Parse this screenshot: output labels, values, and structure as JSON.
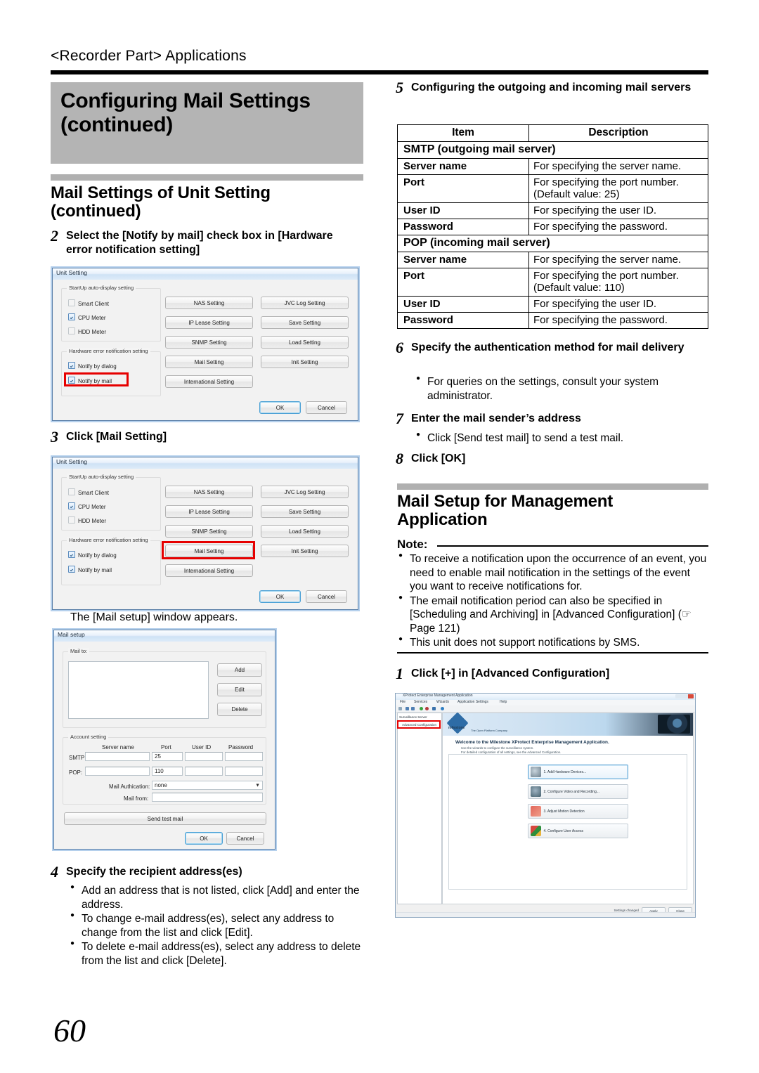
{
  "running_head": "<Recorder Part> Applications",
  "chapter_title": "Configuring Mail Settings\n(continued)",
  "page_number": "60",
  "left_column": {
    "section_heading": "Mail Settings of Unit Setting\n(continued)",
    "step2": {
      "num": "2",
      "text": "Select the [Notify by mail] check box in [Hardware error notification setting]"
    },
    "step3": {
      "num": "3",
      "text": "Click [Mail Setting]"
    },
    "caption_mail_setup": "The [Mail setup] window appears.",
    "step4": {
      "num": "4",
      "text": "Specify the recipient address(es)",
      "bullets": [
        "Add an address that is not listed, click [Add] and enter the address.",
        "To change e-mail address(es), select any address to change from the list and click [Edit].",
        "To delete e-mail address(es), select any address to delete from the list and click [Delete]."
      ]
    }
  },
  "right_column": {
    "step5": {
      "num": "5",
      "text": "Configuring the outgoing and incoming mail servers"
    },
    "table": {
      "headers": [
        "Item",
        "Description"
      ],
      "groups": [
        {
          "group_label": "SMTP (outgoing mail server)",
          "rows": [
            {
              "item": "Server name",
              "description": "For specifying the server name."
            },
            {
              "item": "Port",
              "description": "For specifying the port number.\n(Default value: 25)"
            },
            {
              "item": "User ID",
              "description": "For specifying the user ID."
            },
            {
              "item": "Password",
              "description": "For specifying the password."
            }
          ]
        },
        {
          "group_label": "POP (incoming mail server)",
          "rows": [
            {
              "item": "Server name",
              "description": "For specifying the server name."
            },
            {
              "item": "Port",
              "description": "For specifying the port number.\n(Default value: 110)"
            },
            {
              "item": "User ID",
              "description": "For specifying the user ID."
            },
            {
              "item": "Password",
              "description": "For specifying the password."
            }
          ]
        }
      ]
    },
    "step6": {
      "num": "6",
      "text": "Specify the authentication method for mail delivery",
      "bullets": [
        "For queries on the settings, consult your system administrator."
      ]
    },
    "step7": {
      "num": "7",
      "text": "Enter the mail sender’s address",
      "bullets": [
        "Click [Send test mail] to send a test mail."
      ]
    },
    "step8": {
      "num": "8",
      "text": "Click [OK]"
    },
    "section_heading2": "Mail Setup for Management\nApplication",
    "note_label": "Note:",
    "note_bullets": [
      "To receive a notification upon the occurrence of an event, you need to enable mail notification in the settings of the event you want to receive notifications for.",
      "The email notification period can also be specified in [Scheduling and Archiving] in [Advanced Configuration] (☞ Page 121)",
      "This unit does not support notifications by SMS."
    ],
    "step1b": {
      "num": "1",
      "text": "Click [+] in [Advanced Configuration]"
    }
  },
  "unit_setting_dialog": {
    "title": "Unit Setting",
    "group1_label": "StartUp auto-display setting",
    "checkboxes1": [
      {
        "label": "Smart Client",
        "checked": false
      },
      {
        "label": "CPU Meter",
        "checked": true
      },
      {
        "label": "HDD Meter",
        "checked": false
      }
    ],
    "group2_label": "Hardware error notification setting",
    "checkboxes2": [
      {
        "label": "Notify by dialog",
        "checked": true
      },
      {
        "label": "Notify by mail",
        "checked": true
      }
    ],
    "buttons_col1": [
      "NAS Setting",
      "IP Lease Setting",
      "SNMP Setting",
      "Mail Setting",
      "International Setting"
    ],
    "buttons_col2": [
      "JVC Log Setting",
      "Save Setting",
      "Load Setting",
      "Init Setting"
    ],
    "ok": "OK",
    "cancel": "Cancel"
  },
  "mail_setup_dialog": {
    "title": "Mail setup",
    "mail_to_label": "Mail to:",
    "mail_to_items": [],
    "add": "Add",
    "edit": "Edit",
    "delete": "Delete",
    "account_label": "Account setting",
    "col_server": "Server name",
    "col_port": "Port",
    "col_userid": "User ID",
    "col_password": "Password",
    "smtp_label": "SMTP:",
    "smtp_server": "",
    "smtp_port": "25",
    "smtp_userid": "",
    "smtp_password": "",
    "pop_label": "POP:",
    "pop_server": "",
    "pop_port": "110",
    "pop_userid": "",
    "pop_password": "",
    "auth_label": "Mail Authication:",
    "auth_value": "none",
    "from_label": "Mail from:",
    "from_value": "",
    "send_test": "Send test mail",
    "ok": "OK",
    "cancel": "Cancel"
  },
  "xprotect_app": {
    "title": "XProtect Enterprise Management Application",
    "menus": [
      "File",
      "Services",
      "Wizards",
      "Application Settings",
      "Help"
    ],
    "tree": [
      "Surveillance Server",
      "Advanced Configuration"
    ],
    "brand": "milestone",
    "tagline": "The Open Platform Company",
    "welcome": "Welcome to the Milestone XProtect Enterprise Management Application.",
    "welcome_sub1": "Use the wizards to configure the surveillance system.",
    "welcome_sub2": "For detailed configuration of all settings, see the Advanced Configuration.",
    "wizard_buttons": [
      "1. Add Hardware Devices...",
      "2. Configure Video and Recording...",
      "3. Adjust Motion Detection",
      "4. Configure User Access"
    ],
    "footer_status": "Settings changed",
    "footer_apply": "Apply",
    "footer_close": "Close"
  },
  "colors": {
    "highlight": "#e60000",
    "chapter_bg": "#b4b4b4",
    "section_bar": "#b0b0b0"
  }
}
